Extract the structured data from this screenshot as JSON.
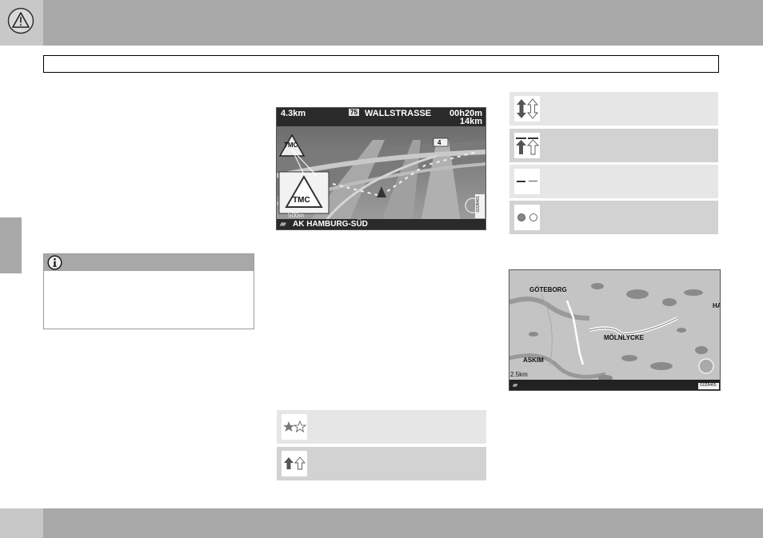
{
  "header": {
    "warning_icon": "warning-triangle-icon"
  },
  "note": {
    "icon": "info-icon"
  },
  "nav_screen": {
    "distance_to_turn": "4.3km",
    "road_badge": "75",
    "street": "WALLSTRASSE",
    "time_remaining": "00h20m",
    "distance_remaining": "14km",
    "tmc_label": "TMC",
    "tmc_label_large": "TMC",
    "exit_badge": "4",
    "scale": "500m",
    "current_road": "AK HAMBURG-SÜD",
    "image_code": "G028461"
  },
  "map_screen": {
    "city_gothenburg": "GÖTEBORG",
    "city_molnlycke": "MÖLNLYCKE",
    "city_askim": "ASKIM",
    "edge_label": "HA",
    "scale": "2.5km",
    "image_code": "G028465"
  },
  "icon_rows_left": [
    {
      "icon": "stars-icon",
      "shade": "light"
    },
    {
      "icon": "arrows-up-icon",
      "shade": "dark"
    }
  ],
  "icon_rows_right": [
    {
      "icon": "double-arrow-updown-icon",
      "shade": "light"
    },
    {
      "icon": "arrow-bar-up-icon",
      "shade": "dark"
    },
    {
      "icon": "dash-lines-icon",
      "shade": "light"
    },
    {
      "icon": "dot-circles-icon",
      "shade": "dark"
    }
  ]
}
